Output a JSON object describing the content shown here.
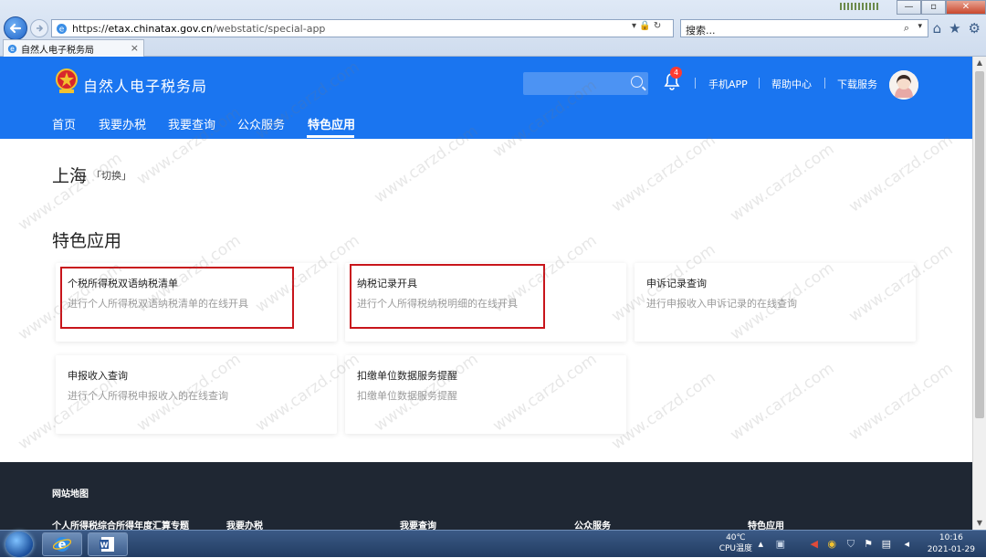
{
  "browser": {
    "url_scheme": "https://",
    "url_host": "etax.chinatax.gov.cn",
    "url_path": "/webstatic/special-app",
    "search_placeholder": "搜索...",
    "tab_title": "自然人电子税务局",
    "tab_close": "×",
    "addr_tools": "▾ 🔒 ↻",
    "search_icon": "⌕",
    "search_dropdown": "▾",
    "win_min": "—",
    "win_max": "▫",
    "win_close": "✕",
    "icon_home": "⌂",
    "icon_fav": "★",
    "icon_gear": "⚙"
  },
  "header": {
    "site_title": "自然人电子税务局",
    "notification_count": "4",
    "links": [
      "手机APP",
      "帮助中心",
      "下载服务"
    ]
  },
  "nav": {
    "items": [
      "首页",
      "我要办税",
      "我要查询",
      "公众服务",
      "特色应用"
    ],
    "active_index": 4
  },
  "page": {
    "region": "上海",
    "region_switch": "「切换」",
    "section_title": "特色应用"
  },
  "cards": [
    {
      "title": "个税所得税双语纳税清单",
      "desc": "进行个人所得税双语纳税清单的在线开具",
      "highlighted": true
    },
    {
      "title": "纳税记录开具",
      "desc": "进行个人所得税纳税明细的在线开具",
      "highlighted": true
    },
    {
      "title": "申诉记录查询",
      "desc": "进行申报收入申诉记录的在线查询",
      "highlighted": false
    },
    {
      "title": "申报收入查询",
      "desc": "进行个人所得税申报收入的在线查询",
      "highlighted": false
    },
    {
      "title": "扣缴单位数据服务提醒",
      "desc": "扣缴单位数据服务提醒",
      "highlighted": false
    }
  ],
  "footer": {
    "site_map": "网站地图",
    "columns": [
      "个人所得税综合所得年度汇算专题",
      "我要办税",
      "我要查询",
      "公众服务",
      "特色应用"
    ]
  },
  "watermark": "www.carzd.com",
  "taskbar": {
    "temperature": "40℃",
    "cpu_label": "CPU温度",
    "time": "10:16",
    "date": "2021-01-29"
  },
  "colors": {
    "brand_blue": "#1a75f0",
    "highlight_red": "#c8151b",
    "footer_bg": "#1f2733",
    "notification_red": "#ff3b30"
  }
}
